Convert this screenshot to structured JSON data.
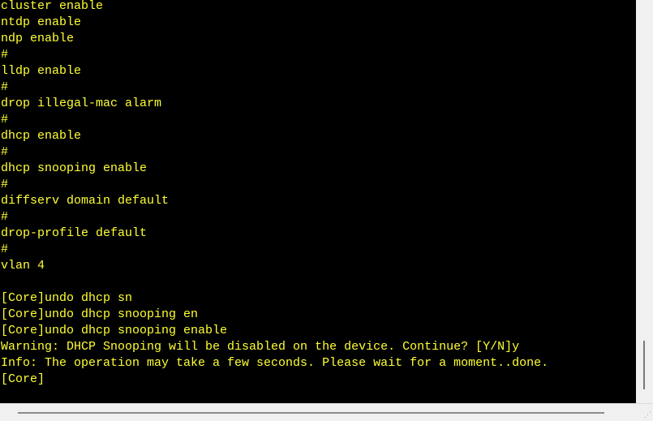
{
  "terminal": {
    "text_color": "#ffff33",
    "background_color": "#000000",
    "lines": [
      "cluster enable",
      "ntdp enable",
      "ndp enable",
      "#",
      "lldp enable",
      "#",
      "drop illegal-mac alarm",
      "#",
      "dhcp enable",
      "#",
      "dhcp snooping enable",
      "#",
      "diffserv domain default",
      "#",
      "drop-profile default",
      "#",
      "vlan 4",
      "",
      "[Core]undo dhcp sn",
      "[Core]undo dhcp snooping en",
      "[Core]undo dhcp snooping enable",
      "Warning: DHCP Snooping will be disabled on the device. Continue? [Y/N]y",
      "Info: The operation may take a few seconds. Please wait for a moment..done.",
      "[Core]"
    ]
  },
  "scrollbars": {
    "vertical_icon": "vertical-scrollbar",
    "horizontal_icon": "horizontal-scrollbar",
    "grip_icon": "resize-grip-icon"
  }
}
